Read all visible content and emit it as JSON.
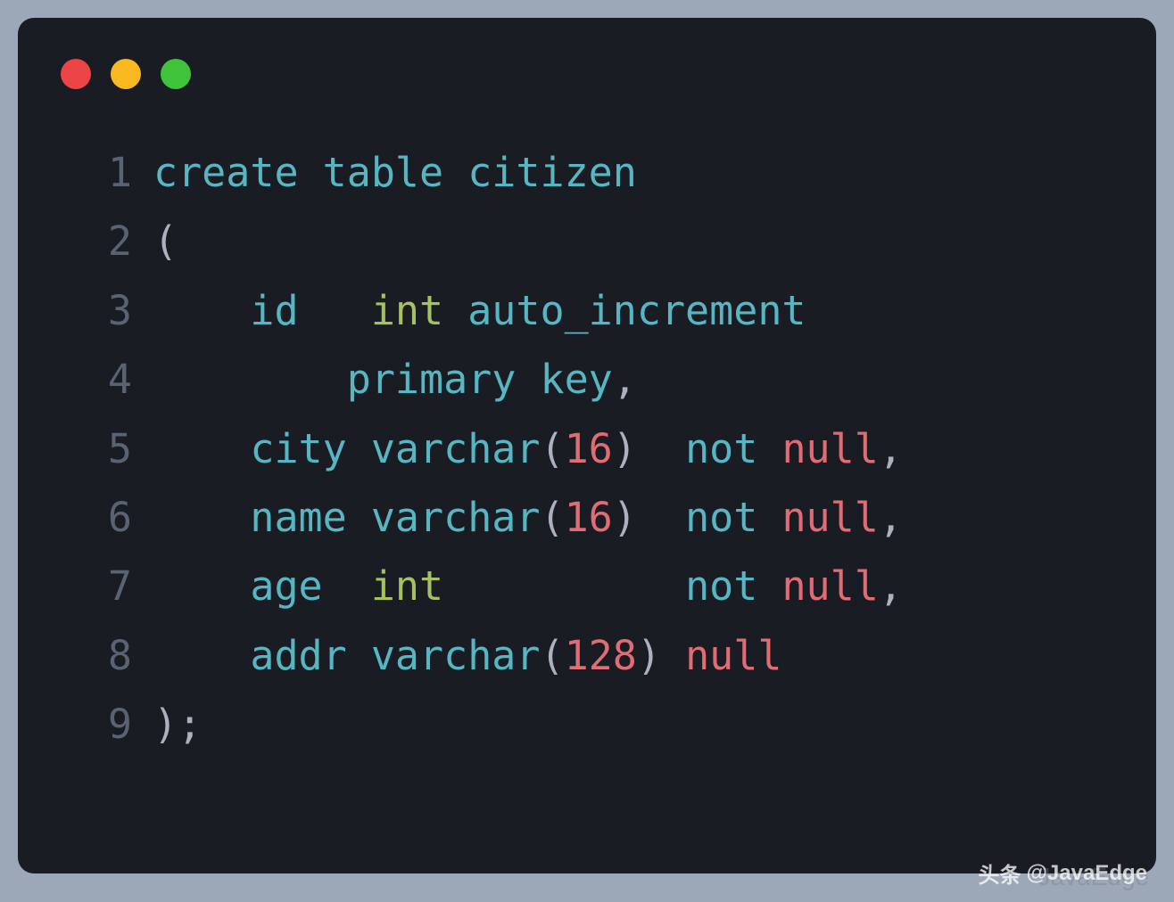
{
  "traffic_lights": {
    "red": "#ed4446",
    "yellow": "#f8b920",
    "green": "#3ec33a"
  },
  "code": {
    "lines": [
      {
        "num": "1",
        "tokens": [
          {
            "cls": "kw-blue",
            "text": "create"
          },
          {
            "cls": "plain",
            "text": " "
          },
          {
            "cls": "kw-blue",
            "text": "table"
          },
          {
            "cls": "plain",
            "text": " "
          },
          {
            "cls": "ident",
            "text": "citizen"
          }
        ]
      },
      {
        "num": "2",
        "tokens": [
          {
            "cls": "punct",
            "text": "("
          }
        ]
      },
      {
        "num": "3",
        "tokens": [
          {
            "cls": "plain",
            "text": "    "
          },
          {
            "cls": "ident",
            "text": "id"
          },
          {
            "cls": "plain",
            "text": "   "
          },
          {
            "cls": "kw-green",
            "text": "int"
          },
          {
            "cls": "plain",
            "text": " "
          },
          {
            "cls": "ident",
            "text": "auto_increment"
          }
        ]
      },
      {
        "num": "4",
        "tokens": [
          {
            "cls": "plain",
            "text": "        "
          },
          {
            "cls": "ident",
            "text": "primary"
          },
          {
            "cls": "plain",
            "text": " "
          },
          {
            "cls": "ident",
            "text": "key"
          },
          {
            "cls": "punct",
            "text": ","
          }
        ]
      },
      {
        "num": "5",
        "tokens": [
          {
            "cls": "plain",
            "text": "    "
          },
          {
            "cls": "ident",
            "text": "city"
          },
          {
            "cls": "plain",
            "text": " "
          },
          {
            "cls": "ident",
            "text": "varchar"
          },
          {
            "cls": "punct",
            "text": "("
          },
          {
            "cls": "kw-num",
            "text": "16"
          },
          {
            "cls": "punct",
            "text": ")"
          },
          {
            "cls": "plain",
            "text": "  "
          },
          {
            "cls": "ident",
            "text": "not"
          },
          {
            "cls": "plain",
            "text": " "
          },
          {
            "cls": "kw-red",
            "text": "null"
          },
          {
            "cls": "punct",
            "text": ","
          }
        ]
      },
      {
        "num": "6",
        "tokens": [
          {
            "cls": "plain",
            "text": "    "
          },
          {
            "cls": "ident",
            "text": "name"
          },
          {
            "cls": "plain",
            "text": " "
          },
          {
            "cls": "ident",
            "text": "varchar"
          },
          {
            "cls": "punct",
            "text": "("
          },
          {
            "cls": "kw-num",
            "text": "16"
          },
          {
            "cls": "punct",
            "text": ")"
          },
          {
            "cls": "plain",
            "text": "  "
          },
          {
            "cls": "ident",
            "text": "not"
          },
          {
            "cls": "plain",
            "text": " "
          },
          {
            "cls": "kw-red",
            "text": "null"
          },
          {
            "cls": "punct",
            "text": ","
          }
        ]
      },
      {
        "num": "7",
        "tokens": [
          {
            "cls": "plain",
            "text": "    "
          },
          {
            "cls": "ident",
            "text": "age"
          },
          {
            "cls": "plain",
            "text": "  "
          },
          {
            "cls": "kw-green",
            "text": "int"
          },
          {
            "cls": "plain",
            "text": "          "
          },
          {
            "cls": "ident",
            "text": "not"
          },
          {
            "cls": "plain",
            "text": " "
          },
          {
            "cls": "kw-red",
            "text": "null"
          },
          {
            "cls": "punct",
            "text": ","
          }
        ]
      },
      {
        "num": "8",
        "tokens": [
          {
            "cls": "plain",
            "text": "    "
          },
          {
            "cls": "ident",
            "text": "addr"
          },
          {
            "cls": "plain",
            "text": " "
          },
          {
            "cls": "ident",
            "text": "varchar"
          },
          {
            "cls": "punct",
            "text": "("
          },
          {
            "cls": "kw-num",
            "text": "128"
          },
          {
            "cls": "punct",
            "text": ")"
          },
          {
            "cls": "plain",
            "text": " "
          },
          {
            "cls": "kw-red",
            "text": "null"
          }
        ]
      },
      {
        "num": "9",
        "tokens": [
          {
            "cls": "punct",
            "text": ")"
          },
          {
            "cls": "punct",
            "text": ";"
          }
        ]
      }
    ]
  },
  "watermark": {
    "brand": "头条",
    "handle": "@JavaEdge",
    "faded": "JavaEdge"
  }
}
